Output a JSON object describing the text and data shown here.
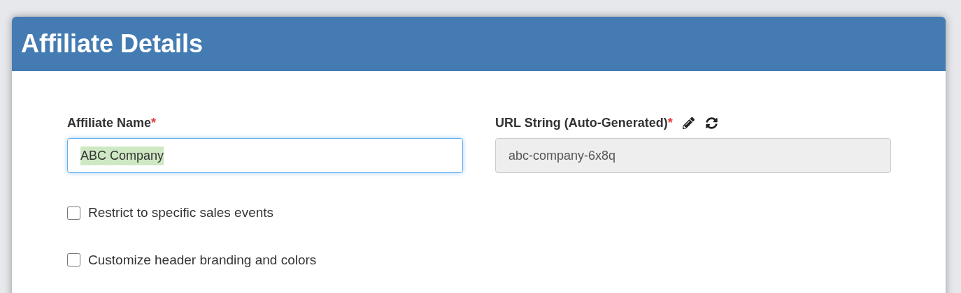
{
  "panel": {
    "title": "Affiliate Details"
  },
  "fields": [
    {
      "label": "Affiliate Name",
      "required_mark": "*",
      "value": "ABC Company",
      "focused": true,
      "text_selected": true,
      "disabled": false
    },
    {
      "label": "URL String (Auto-Generated)",
      "required_mark": "*",
      "value": "abc-company-6x8q",
      "focused": false,
      "text_selected": false,
      "disabled": true,
      "actions": [
        {
          "kind": "edit"
        },
        {
          "kind": "refresh"
        }
      ]
    }
  ],
  "checkboxes": [
    {
      "label": "Restrict to specific sales events",
      "checked": false
    },
    {
      "label": "Customize header branding and colors",
      "checked": false
    }
  ]
}
